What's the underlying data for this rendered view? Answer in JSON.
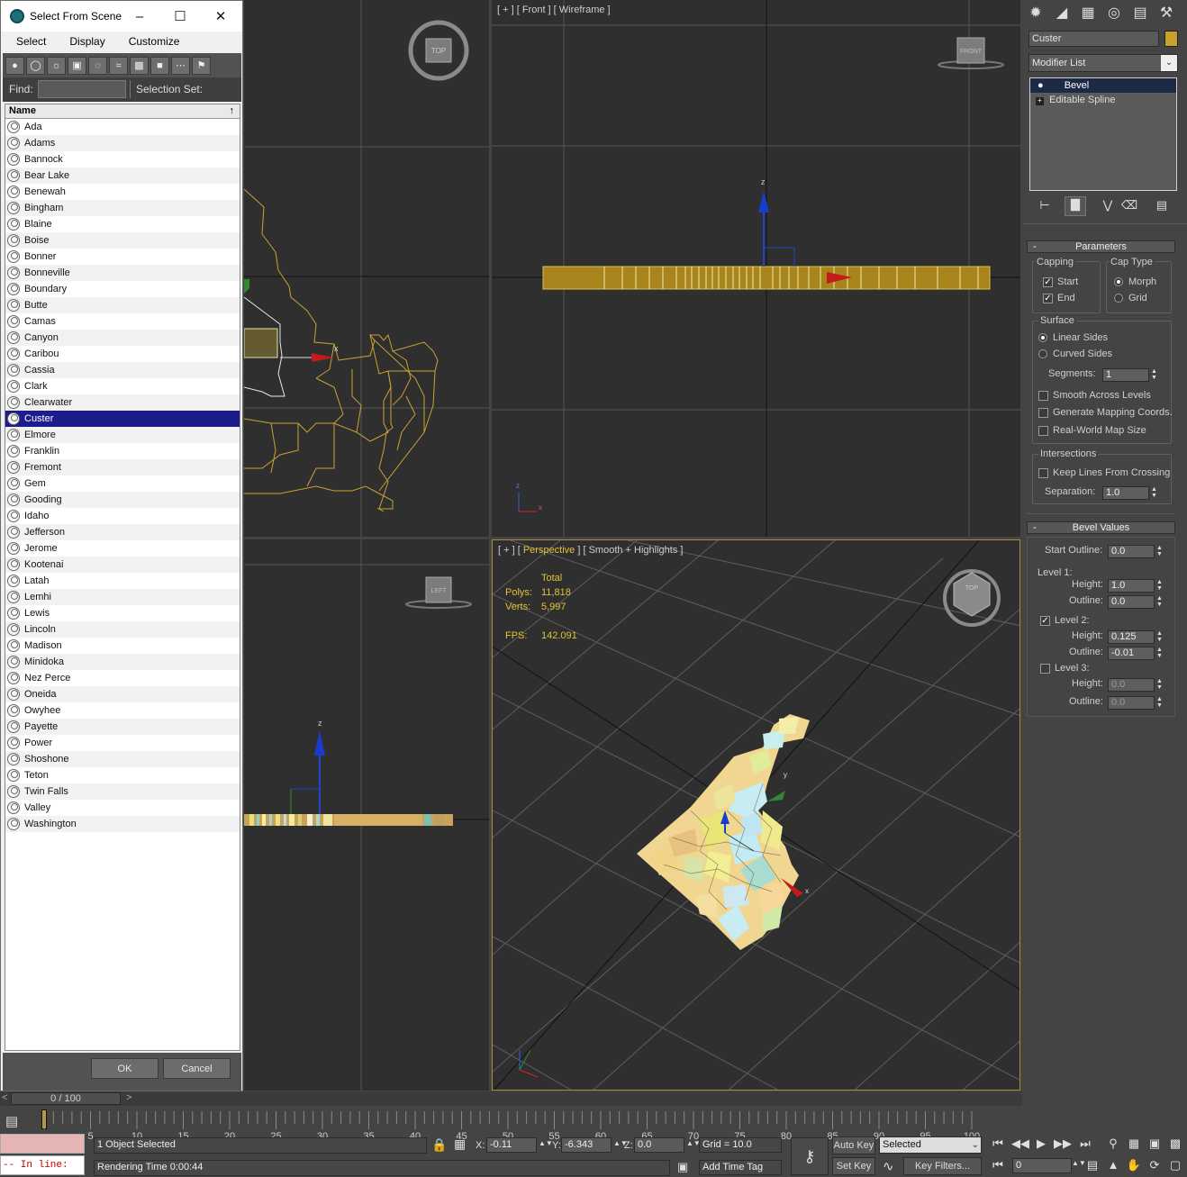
{
  "dialog": {
    "title": "Select From Scene",
    "menu": [
      "Select",
      "Display",
      "Customize"
    ],
    "find_label": "Find:",
    "selection_set_label": "Selection Set:",
    "column_header": "Name",
    "sort_indicator": "↑",
    "items": [
      "Ada",
      "Adams",
      "Bannock",
      "Bear Lake",
      "Benewah",
      "Bingham",
      "Blaine",
      "Boise",
      "Bonner",
      "Bonneville",
      "Boundary",
      "Butte",
      "Camas",
      "Canyon",
      "Caribou",
      "Cassia",
      "Clark",
      "Clearwater",
      "Custer",
      "Elmore",
      "Franklin",
      "Fremont",
      "Gem",
      "Gooding",
      "Idaho",
      "Jefferson",
      "Jerome",
      "Kootenai",
      "Latah",
      "Lemhi",
      "Lewis",
      "Lincoln",
      "Madison",
      "Minidoka",
      "Nez Perce",
      "Oneida",
      "Owyhee",
      "Payette",
      "Power",
      "Shoshone",
      "Teton",
      "Twin Falls",
      "Valley",
      "Washington"
    ],
    "selected_item": "Custer",
    "ok_label": "OK",
    "cancel_label": "Cancel"
  },
  "viewports": {
    "front_label_a": "[ + ]",
    "front_label_b": " [ Front ] [ Wireframe ]",
    "persp_label_a": "[ + ] [ ",
    "persp_label_hl": "Perspective",
    "persp_label_b": " ] [ Smooth + Highlights ]",
    "cube_top": "TOP",
    "cube_front": "FRONT",
    "cube_left": "LEFT",
    "stats": {
      "total": "Total",
      "polys_label": "Polys:",
      "polys": "11,818",
      "verts_label": "Verts:",
      "verts": "5,997",
      "fps_label": "FPS:",
      "fps": "142.091"
    }
  },
  "command_panel": {
    "object_name": "Custer",
    "object_color": "#c8a02c",
    "modifier_list": "Modifier List",
    "stack": [
      "Bevel",
      "Editable Spline"
    ],
    "parameters_title": "Parameters",
    "capping_label": "Capping",
    "cap_start": "Start",
    "cap_end": "End",
    "cap_type_label": "Cap Type",
    "morph": "Morph",
    "grid": "Grid",
    "surface_label": "Surface",
    "linear_sides": "Linear Sides",
    "curved_sides": "Curved Sides",
    "segments_label": "Segments:",
    "segments": "1",
    "smooth_across": "Smooth Across Levels",
    "gen_mapping": "Generate Mapping Coords.",
    "real_world": "Real-World Map Size",
    "intersections_label": "Intersections",
    "keep_lines": "Keep Lines From Crossing",
    "separation_label": "Separation:",
    "separation": "1.0",
    "bevel_values_title": "Bevel Values",
    "start_outline_label": "Start Outline:",
    "start_outline": "0.0",
    "level1_label": "Level 1:",
    "height_label": "Height:",
    "outline_label": "Outline:",
    "l1_height": "1.0",
    "l1_outline": "0.0",
    "level2_label": "Level 2:",
    "l2_height": "0.125",
    "l2_outline": "-0.01",
    "level3_label": "Level 3:",
    "l3_height": "0.0",
    "l3_outline": "0.0"
  },
  "timeline": {
    "frame_counter": "0 / 100",
    "ticks": [
      "5",
      "10",
      "15",
      "20",
      "25",
      "30",
      "35",
      "40",
      "45",
      "50",
      "55",
      "60",
      "65",
      "70",
      "75",
      "80",
      "85",
      "90",
      "95",
      "100"
    ]
  },
  "status": {
    "maxscript": "-- In line:",
    "selected_count": "1 Object Selected",
    "rendering_time": "Rendering Time  0:00:44",
    "x_label": "X:",
    "x": "-0.11",
    "y_label": "Y:",
    "y": "-6.343",
    "z_label": "Z:",
    "z": "0.0",
    "grid": "Grid = 10.0",
    "add_time_tag": "Add Time Tag",
    "auto_key": "Auto Key",
    "selected_dropdown": "Selected",
    "set_key": "Set Key",
    "key_filters": "Key Filters...",
    "current_frame": "0"
  }
}
